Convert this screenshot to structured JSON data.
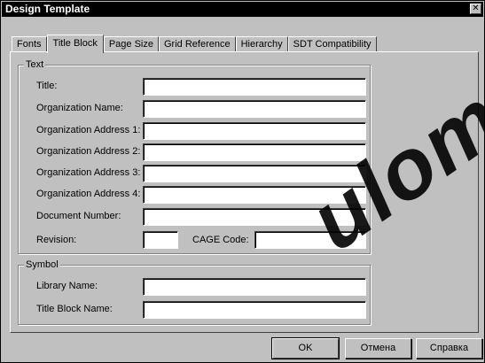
{
  "window": {
    "title": "Design Template",
    "close_glyph": "✕"
  },
  "tabs": [
    {
      "label": "Fonts"
    },
    {
      "label": "Title Block"
    },
    {
      "label": "Page Size"
    },
    {
      "label": "Grid Reference"
    },
    {
      "label": "Hierarchy"
    },
    {
      "label": "SDT Compatibility"
    }
  ],
  "active_tab": "Title Block",
  "text_group": {
    "legend": "Text",
    "fields": [
      {
        "label": "Title:",
        "value": ""
      },
      {
        "label": "Organization Name:",
        "value": ""
      },
      {
        "label": "Organization Address 1:",
        "value": ""
      },
      {
        "label": "Organization Address 2:",
        "value": ""
      },
      {
        "label": "Organization Address 3:",
        "value": ""
      },
      {
        "label": "Organization Address 4:",
        "value": ""
      },
      {
        "label": "Document Number:",
        "value": ""
      }
    ],
    "revision": {
      "label": "Revision:",
      "value": ""
    },
    "cage_code": {
      "label": "CAGE Code:",
      "value": ""
    }
  },
  "symbol_group": {
    "legend": "Symbol",
    "library_name": {
      "label": "Library Name:",
      "value": ""
    },
    "title_block_name": {
      "label": "Title Block Name:",
      "value": ""
    }
  },
  "buttons": {
    "ok": "OK",
    "cancel": "Отмена",
    "help": "Справка"
  },
  "watermark_text": "ulom"
}
